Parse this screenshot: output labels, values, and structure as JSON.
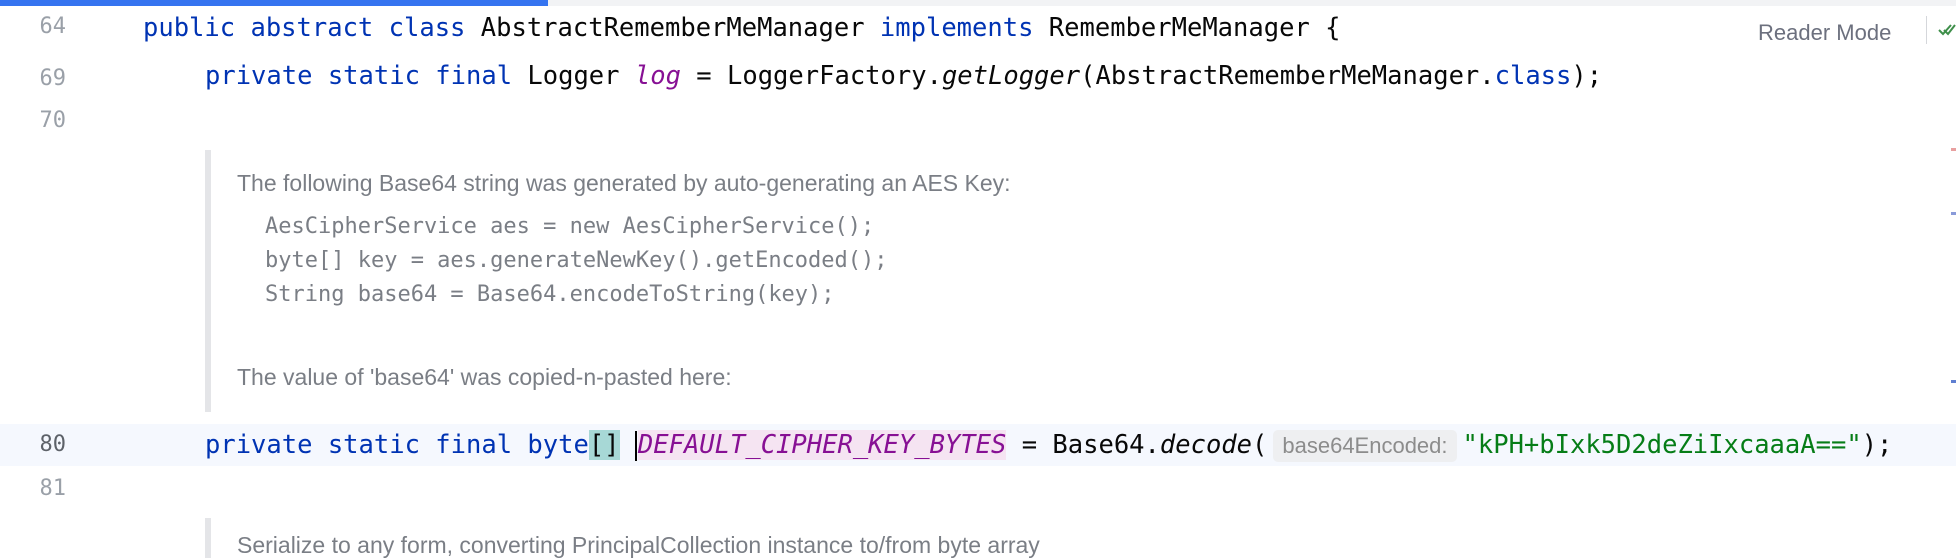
{
  "editor": {
    "progress_fraction": 0.28,
    "line_numbers": {
      "l64": "64",
      "l69": "69",
      "l70": "70",
      "l80": "80",
      "l81": "81"
    },
    "line64": {
      "kw1": "public abstract class",
      "name": " AbstractRememberMeManager ",
      "kw2": "implements",
      "iface": " RememberMeManager {"
    },
    "line69": {
      "kw": "private static final",
      "type": " Logger ",
      "field": "log",
      "assign": " = LoggerFactory.",
      "method": "getLogger",
      "arg": "(AbstractRememberMeManager.",
      "cls": "class",
      "end": ");"
    },
    "doc": {
      "intro": "The following Base64 string was generated by auto-generating an AES Key:",
      "code1": "AesCipherService aes = new AesCipherService();",
      "code2": "byte[] key = aes.generateNewKey().getEncoded();",
      "code3": "String base64 = Base64.encodeToString(key);",
      "outro": "The value of 'base64' was copied-n-pasted here:",
      "next_partial": "Serialize to any form, converting PrincipalCollection instance to/from byte array"
    },
    "line80": {
      "kw": "private static final",
      "type_start": " byte",
      "brackets": "[]",
      "const": "DEFAULT_CIPHER_KEY_BYTES",
      "assign": " = Base64.",
      "method": "decode",
      "open": "(",
      "hint": "base64Encoded:",
      "string": "\"kPH+bIxk5D2deZiIxcaaaA==\"",
      "end": ");"
    }
  },
  "toolbar": {
    "reader_mode_label": "Reader Mode",
    "check_icon": "double-check-icon"
  },
  "colors": {
    "keyword": "#0033b3",
    "static_field": "#871094",
    "string": "#067d17",
    "accent": "#3574f0"
  }
}
